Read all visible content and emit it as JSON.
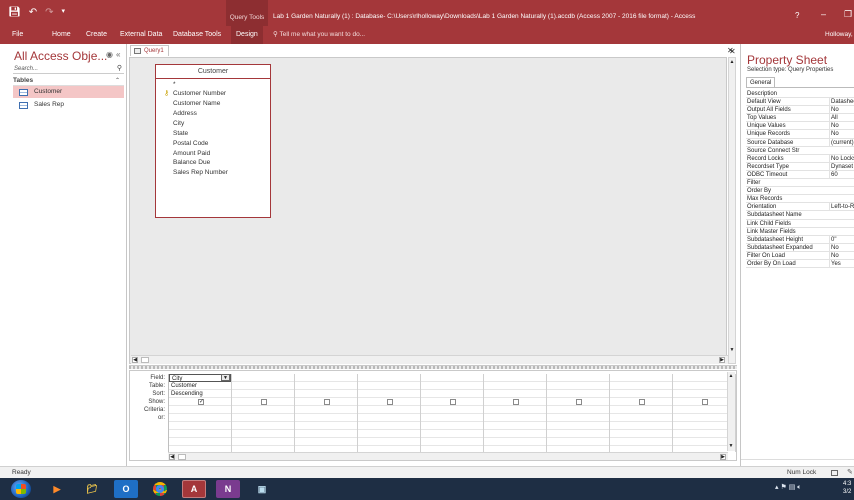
{
  "window": {
    "title": "Lab 1 Garden Naturally (1) : Database- C:\\Users\\rlholloway\\Downloads\\Lab 1 Garden Naturally (1).accdb (Access 2007 - 2016 file format) - Access",
    "contextual_tab": "Query Tools",
    "help": "?",
    "user": "Holloway,"
  },
  "ribbon": {
    "tabs": [
      "File",
      "Home",
      "Create",
      "External Data",
      "Database Tools",
      "Design"
    ],
    "active_tab": "Design",
    "tell_me": "Tell me what you want to do..."
  },
  "nav": {
    "title": "All Access Obje...",
    "search_placeholder": "Search...",
    "group": "Tables",
    "items": [
      {
        "label": "Customer",
        "selected": true
      },
      {
        "label": "Sales Rep",
        "selected": false
      }
    ]
  },
  "document": {
    "tab_label": "Query1",
    "table": {
      "title": "Customer",
      "fields": [
        "*",
        "Customer Number",
        "Customer Name",
        "Address",
        "City",
        "State",
        "Postal Code",
        "Amount Paid",
        "Balance Due",
        "Sales Rep Number"
      ],
      "key_field": "Customer Number"
    }
  },
  "qbe": {
    "row_labels": [
      "Field:",
      "Table:",
      "Sort:",
      "Show:",
      "Criteria:",
      "or:"
    ],
    "columns": [
      {
        "field": "City",
        "table": "Customer",
        "sort": "Descending",
        "show": true
      },
      {
        "field": "",
        "table": "",
        "sort": "",
        "show": false
      },
      {
        "field": "",
        "table": "",
        "sort": "",
        "show": false
      },
      {
        "field": "",
        "table": "",
        "sort": "",
        "show": false
      },
      {
        "field": "",
        "table": "",
        "sort": "",
        "show": false
      },
      {
        "field": "",
        "table": "",
        "sort": "",
        "show": false
      },
      {
        "field": "",
        "table": "",
        "sort": "",
        "show": false
      },
      {
        "field": "",
        "table": "",
        "sort": "",
        "show": false
      },
      {
        "field": "",
        "table": "",
        "sort": "",
        "show": false
      }
    ]
  },
  "property_sheet": {
    "title": "Property Sheet",
    "selection_type": "Selection type:  Query Properties",
    "tab": "General",
    "rows": [
      {
        "name": "Description",
        "value": ""
      },
      {
        "name": "Default View",
        "value": "Datasheet"
      },
      {
        "name": "Output All Fields",
        "value": "No"
      },
      {
        "name": "Top Values",
        "value": "All"
      },
      {
        "name": "Unique Values",
        "value": "No"
      },
      {
        "name": "Unique Records",
        "value": "No"
      },
      {
        "name": "Source Database",
        "value": "(current)"
      },
      {
        "name": "Source Connect Str",
        "value": ""
      },
      {
        "name": "Record Locks",
        "value": "No Locks"
      },
      {
        "name": "Recordset Type",
        "value": "Dynaset"
      },
      {
        "name": "ODBC Timeout",
        "value": "60"
      },
      {
        "name": "Filter",
        "value": ""
      },
      {
        "name": "Order By",
        "value": ""
      },
      {
        "name": "Max Records",
        "value": ""
      },
      {
        "name": "Orientation",
        "value": "Left-to-Right"
      },
      {
        "name": "Subdatasheet Name",
        "value": ""
      },
      {
        "name": "Link Child Fields",
        "value": ""
      },
      {
        "name": "Link Master Fields",
        "value": ""
      },
      {
        "name": "Subdatasheet Height",
        "value": "0\""
      },
      {
        "name": "Subdatasheet Expanded",
        "value": "No"
      },
      {
        "name": "Filter On Load",
        "value": "No"
      },
      {
        "name": "Order By On Load",
        "value": "Yes"
      }
    ]
  },
  "status": {
    "left": "Ready",
    "num_lock": "Num Lock"
  },
  "taskbar": {
    "apps": [
      "windows-media-player",
      "file-explorer",
      "outlook",
      "chrome",
      "access",
      "onenote",
      "remote-desktop"
    ],
    "clock": "4:3\n3/2"
  }
}
